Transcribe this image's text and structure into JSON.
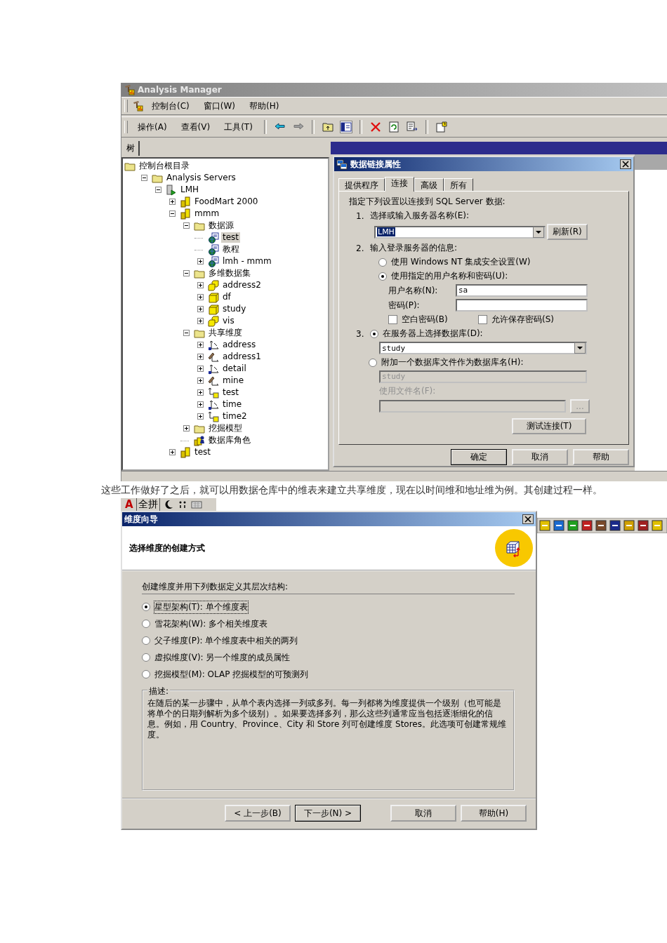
{
  "app_window": {
    "title": "Analysis Manager",
    "menu": [
      "控制台(C)",
      "窗口(W)",
      "帮助(H)"
    ],
    "toolbar_menu": [
      "操作(A)",
      "查看(V)",
      "工具(T)"
    ],
    "pane_tab": "树",
    "tree": [
      {
        "label": "控制台根目录",
        "kind": "folder",
        "expandable": false,
        "selected": false,
        "children": [
          {
            "label": "Analysis Servers",
            "kind": "folder",
            "expandable": true,
            "expanded": true,
            "selected": false,
            "children": [
              {
                "label": "LMH",
                "kind": "server",
                "expandable": true,
                "expanded": true,
                "selected": false,
                "children": [
                  {
                    "label": "FoodMart 2000",
                    "kind": "database",
                    "expandable": true,
                    "expanded": false,
                    "selected": false
                  },
                  {
                    "label": "mmm",
                    "kind": "database",
                    "expandable": true,
                    "expanded": true,
                    "selected": false,
                    "children": [
                      {
                        "label": "数据源",
                        "kind": "folder",
                        "expandable": true,
                        "expanded": true,
                        "selected": false,
                        "children": [
                          {
                            "label": "test",
                            "kind": "datasource",
                            "expandable": false,
                            "selected": true
                          },
                          {
                            "label": "教程",
                            "kind": "datasource",
                            "expandable": false,
                            "selected": false
                          },
                          {
                            "label": "lmh - mmm",
                            "kind": "datasource",
                            "expandable": true,
                            "expanded": false,
                            "selected": false
                          }
                        ]
                      },
                      {
                        "label": "多维数据集",
                        "kind": "folder",
                        "expandable": true,
                        "expanded": true,
                        "selected": false,
                        "children": [
                          {
                            "label": "address2",
                            "kind": "virtual-cube",
                            "expandable": true,
                            "expanded": false,
                            "selected": false
                          },
                          {
                            "label": "df",
                            "kind": "cube",
                            "expandable": true,
                            "expanded": false,
                            "selected": false
                          },
                          {
                            "label": "study",
                            "kind": "cube",
                            "expandable": true,
                            "expanded": false,
                            "selected": false
                          },
                          {
                            "label": "vis",
                            "kind": "virtual-cube",
                            "expandable": true,
                            "expanded": false,
                            "selected": false
                          }
                        ]
                      },
                      {
                        "label": "共享维度",
                        "kind": "folder",
                        "expandable": true,
                        "expanded": true,
                        "selected": false,
                        "children": [
                          {
                            "label": "address",
                            "kind": "dimension",
                            "expandable": true,
                            "expanded": false,
                            "selected": false
                          },
                          {
                            "label": "address1",
                            "kind": "private-dimension",
                            "expandable": true,
                            "expanded": false,
                            "selected": false
                          },
                          {
                            "label": "detail",
                            "kind": "dimension",
                            "expandable": true,
                            "expanded": false,
                            "selected": false
                          },
                          {
                            "label": "mine",
                            "kind": "private-dimension",
                            "expandable": true,
                            "expanded": false,
                            "selected": false
                          },
                          {
                            "label": "test",
                            "kind": "virtual-dimension",
                            "expandable": true,
                            "expanded": false,
                            "selected": false
                          },
                          {
                            "label": "time",
                            "kind": "dimension",
                            "expandable": true,
                            "expanded": false,
                            "selected": false
                          },
                          {
                            "label": "time2",
                            "kind": "virtual-dimension",
                            "expandable": true,
                            "expanded": false,
                            "selected": false
                          }
                        ]
                      },
                      {
                        "label": "挖掘模型",
                        "kind": "folder",
                        "expandable": true,
                        "expanded": false,
                        "selected": false
                      },
                      {
                        "label": "数据库角色",
                        "kind": "role",
                        "expandable": false,
                        "selected": false
                      }
                    ]
                  },
                  {
                    "label": "test",
                    "kind": "database",
                    "expandable": true,
                    "expanded": false,
                    "selected": false
                  }
                ]
              }
            ]
          }
        ]
      }
    ]
  },
  "link_dialog": {
    "title": "数据链接属性",
    "tabs": [
      {
        "label": "提供程序",
        "selected": false
      },
      {
        "label": "连接",
        "selected": true
      },
      {
        "label": "高级",
        "selected": false
      },
      {
        "label": "所有",
        "selected": false
      }
    ],
    "intro": "指定下列设置以连接到 SQL Server 数据:",
    "step1": {
      "number": "1.",
      "label": "选择或输入服务器名称(E):",
      "server": "LMH",
      "refresh_button": "刷新(R)"
    },
    "step2": {
      "number": "2.",
      "label": "输入登录服务器的信息:",
      "options": [
        {
          "label": "使用 Windows NT 集成安全设置(W)",
          "selected": false
        },
        {
          "label": "使用指定的用户名称和密码(U):",
          "selected": true
        }
      ],
      "user_label": "用户名称(N):",
      "user": "sa",
      "password_label": "密码(P):",
      "checkboxes": [
        {
          "label": "空白密码(B)",
          "checked": false
        },
        {
          "label": "允许保存密码(S)",
          "checked": false
        }
      ]
    },
    "step3": {
      "number": "3.",
      "options": [
        {
          "label": "在服务器上选择数据库(D):",
          "selected": true
        },
        {
          "label": "附加一个数据库文件作为数据库名(H):",
          "selected": false
        }
      ],
      "database": "study",
      "attach_name": "study",
      "file_label": "使用文件名(F):",
      "browse_button": "...",
      "test_button": "测试连接(T)"
    },
    "buttons": [
      {
        "label": "确定",
        "default": true
      },
      {
        "label": "取消",
        "default": false
      },
      {
        "label": "帮助",
        "default": false
      }
    ]
  },
  "paragraph": "这些工作做好了之后，就可以用数据仓库中的维表来建立共享维度，现在以时间维和地址维为例。其创建过程一样。",
  "ime_bar": {
    "lang": "A",
    "mode": "全拼"
  },
  "wizard": {
    "title": "维度向导",
    "heading": "选择维度的创建方式",
    "group_label": "创建维度并用下列数据定义其层次结构:",
    "options": [
      {
        "label": "星型架构(T): 单个维度表",
        "selected": true
      },
      {
        "label": "雪花架构(W): 多个相关维度表",
        "selected": false
      },
      {
        "label": "父子维度(P): 单个维度表中相关的两列",
        "selected": false
      },
      {
        "label": "虚拟维度(V): 另一个维度的成员属性",
        "selected": false
      },
      {
        "label": "挖掘模型(M): OLAP 挖掘模型的可预测列",
        "selected": false
      }
    ],
    "description_label": "描述:",
    "description": "在随后的某一步骤中，从单个表内选择一列或多列。每一列都将为维度提供一个级别（也可能是将单个的日期列解析为多个级别）。如果要选择多列，那么这些列通常应当包括逐渐细化的信息。例如，用 Country、Province、City 和 Store 列可创建维度 Stores。此选项可创建常规维度。",
    "buttons": [
      {
        "label": "< 上一步(B)",
        "default": false
      },
      {
        "label": "下一步(N) >",
        "default": true
      },
      {
        "label": "取消",
        "default": false
      },
      {
        "label": "帮助(H)",
        "default": false
      }
    ]
  }
}
